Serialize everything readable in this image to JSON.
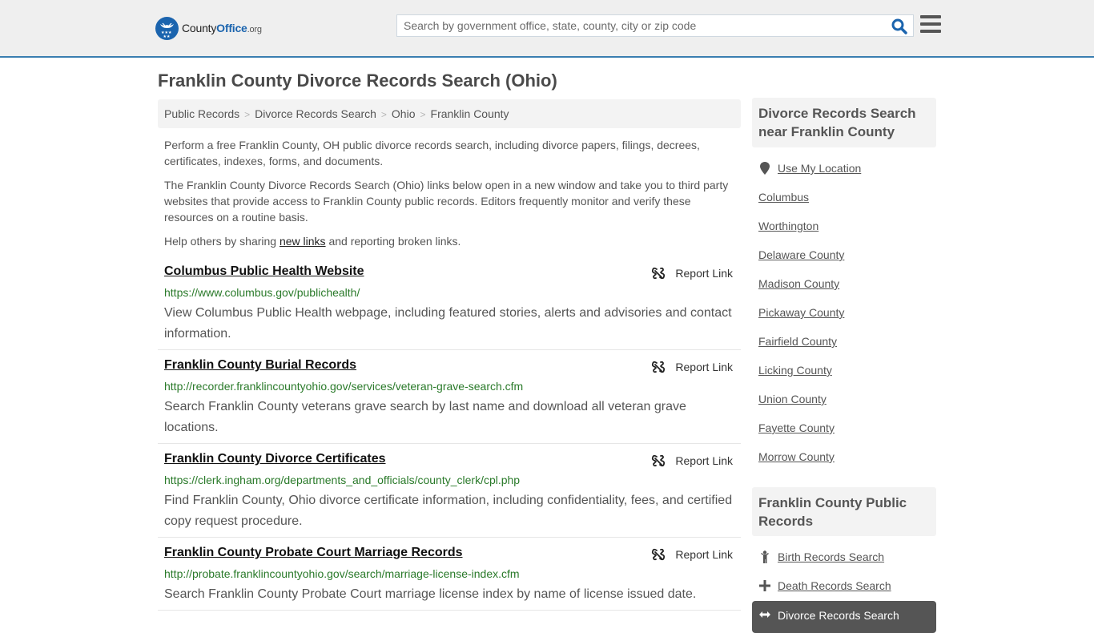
{
  "header": {
    "logo": {
      "name": "County",
      "office": "Office",
      "tld": ".org"
    },
    "search": {
      "placeholder": "Search by government office, state, county, city or zip code",
      "value": ""
    },
    "colors": {
      "brand": "#1b64ae",
      "header_border": "#3a7eb0",
      "url_green": "#2a7a2a"
    }
  },
  "page": {
    "title": "Franklin County Divorce Records Search (Ohio)",
    "breadcrumb": [
      "Public Records",
      "Divorce Records Search",
      "Ohio",
      "Franklin County"
    ],
    "breadcrumb_separator": ">",
    "intro": {
      "p1": "Perform a free Franklin County, OH public divorce records search, including divorce papers, filings, decrees, certificates, indexes, forms, and documents.",
      "p2": "The Franklin County Divorce Records Search (Ohio) links below open in a new window and take you to third party websites that provide access to Franklin County public records. Editors frequently monitor and verify these resources on a routine basis.",
      "p3_before": "Help others by sharing ",
      "p3_link": "new links",
      "p3_after": " and reporting broken links."
    },
    "report_label": "Report Link",
    "listings": [
      {
        "title": "Columbus Public Health Website",
        "url": "https://www.columbus.gov/publichealth/",
        "description": "View Columbus Public Health webpage, including featured stories, alerts and advisories and contact information."
      },
      {
        "title": "Franklin County Burial Records",
        "url": "http://recorder.franklincountyohio.gov/services/veteran-grave-search.cfm",
        "description": "Search Franklin County veterans grave search by last name and download all veteran grave locations."
      },
      {
        "title": "Franklin County Divorce Certificates",
        "url": "https://clerk.ingham.org/departments_and_officials/county_clerk/cpl.php",
        "description": "Find Franklin County, Ohio divorce certificate information, including confidentiality, fees, and certified copy request procedure."
      },
      {
        "title": "Franklin County Probate Court Marriage Records",
        "url": "http://probate.franklincountyohio.gov/search/marriage-license-index.cfm",
        "description": "Search Franklin County Probate Court marriage license index by name of license issued date."
      }
    ]
  },
  "sidebar": {
    "nearby_heading": "Divorce Records Search near Franklin County",
    "use_location": "Use My Location",
    "nearby": [
      "Columbus",
      "Worthington",
      "Delaware County",
      "Madison County",
      "Pickaway County",
      "Fairfield County",
      "Licking County",
      "Union County",
      "Fayette County",
      "Morrow County"
    ],
    "public_heading": "Franklin County Public Records",
    "public_records": [
      {
        "label": "Birth Records Search",
        "icon": "child-icon"
      },
      {
        "label": "Death Records Search",
        "icon": "cross-icon"
      },
      {
        "label": "Divorce Records Search",
        "icon": "arrows-icon",
        "active": true
      }
    ]
  }
}
